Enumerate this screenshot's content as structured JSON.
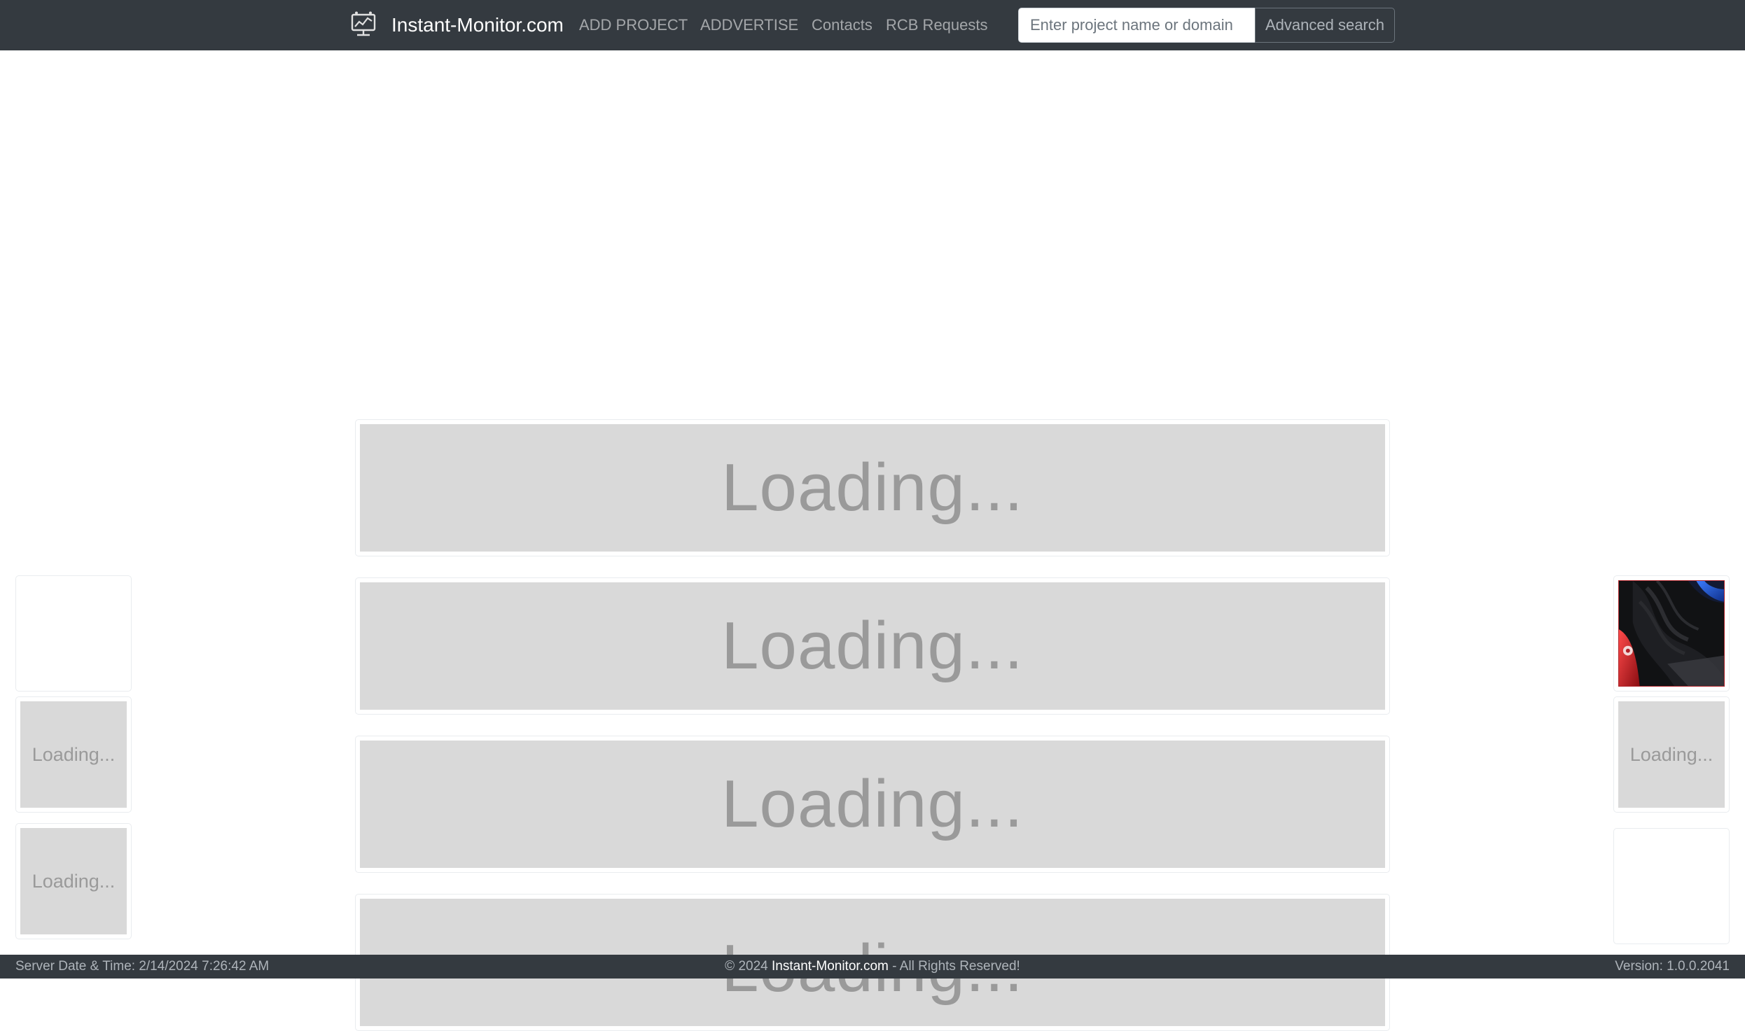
{
  "navbar": {
    "brand_icon": "monitor-chart-icon",
    "brand": "Instant-Monitor.com",
    "links": [
      "ADD PROJECT",
      "ADDVERTISE",
      "Contacts",
      "RCB Requests"
    ],
    "search_placeholder": "Enter project name or domain",
    "search_value": "",
    "advanced_search": "Advanced search"
  },
  "main": {
    "banners": [
      "Loading...",
      "Loading...",
      "Loading...",
      "Loading..."
    ]
  },
  "left_ads": [
    "",
    "Loading...",
    "Loading..."
  ],
  "right_ads": {
    "image_ad": "abstract-red-blue-image",
    "loading": "Loading...",
    "empty": ""
  },
  "footer": {
    "server_time": "Server Date & Time: 2/14/2024 7:26:42 AM",
    "copyright_prefix": "© 2024",
    "site_link": "Instant-Monitor.com",
    "rights": "- All Rights Reserved!",
    "version": "Version: 1.0.0.2041"
  },
  "colors": {
    "navbar_bg": "#343a40",
    "placeholder_bg": "#d9d9d9",
    "placeholder_text": "#9a9a9a"
  }
}
